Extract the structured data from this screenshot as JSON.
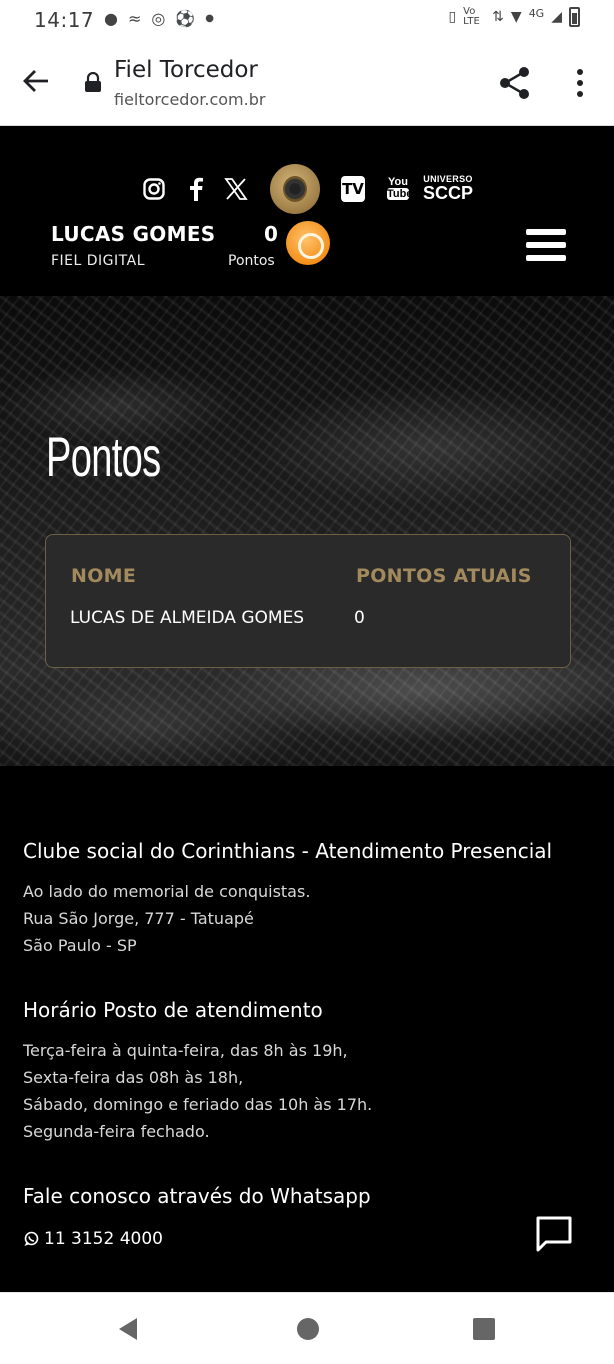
{
  "status_bar": {
    "time": "14:17",
    "network": "4G",
    "volte": "Vo LTE"
  },
  "browser": {
    "title": "Fiel Torcedor",
    "url": "fieltorcedor.com.br"
  },
  "header": {
    "social": [
      "instagram-icon",
      "facebook-icon",
      "x-icon",
      "crest",
      "tv-icon",
      "youtube-icon",
      "universo-sccp"
    ],
    "tv_label": "TV",
    "youtube_label_1": "You",
    "youtube_label_2": "Tube",
    "universo_small": "UNIVERSO",
    "universo_big": "SCCP",
    "user_name": "LUCAS GOMES",
    "user_plan": "FIEL DIGITAL",
    "points_value": "0",
    "points_label": "Pontos"
  },
  "hero": {
    "title": "Pontos",
    "table": {
      "col_name": "NOME",
      "col_points": "PONTOS ATUAIS",
      "row_name": "LUCAS DE ALMEIDA GOMES",
      "row_points": "0"
    }
  },
  "footer": {
    "club_title": "Clube social do Corinthians - Atendimento Presencial",
    "club_lines": [
      "Ao lado do memorial de conquistas.",
      "Rua São Jorge, 777 - Tatuapé",
      "São Paulo - SP"
    ],
    "hours_title": "Horário Posto de atendimento",
    "hours_lines": [
      "Terça-feira à quinta-feira, das 8h às 19h,",
      "Sexta-feira das 08h às 18h,",
      "Sábado, domingo e feriado das 10h às 17h.",
      "Segunda-feira fechado."
    ],
    "whatsapp_title": "Fale conosco através do Whatsapp",
    "whatsapp_number": "11 3152 4000"
  },
  "colors": {
    "gold": "#a28a5d",
    "background": "#000000",
    "card": "#2a2a2a"
  }
}
